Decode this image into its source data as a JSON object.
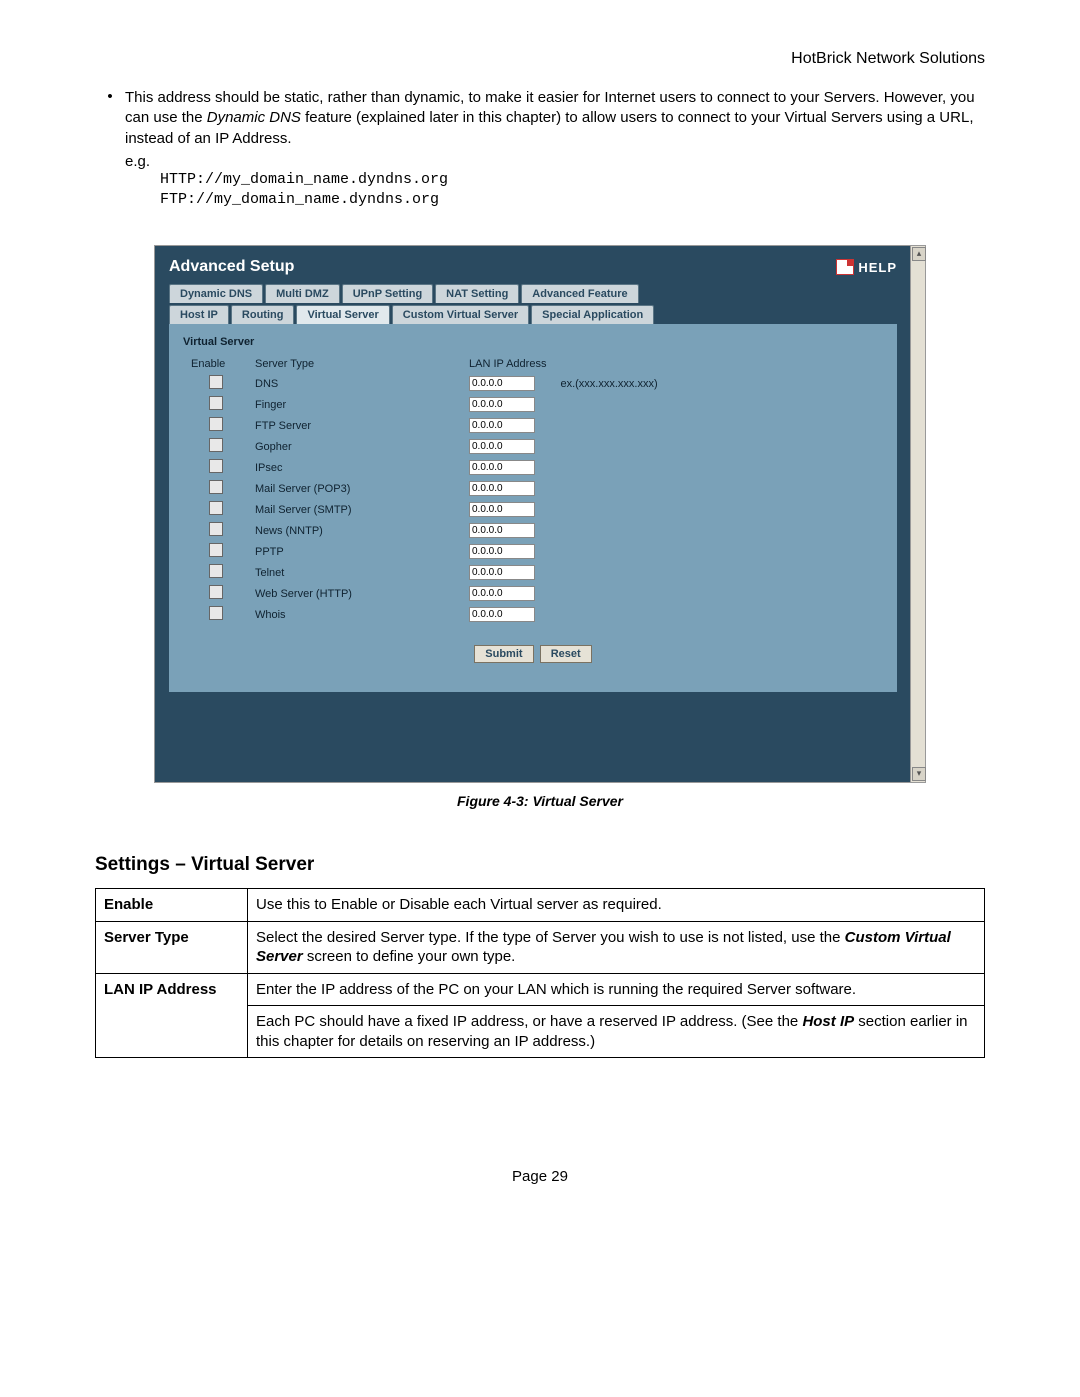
{
  "header": {
    "brand": "HotBrick Network Solutions"
  },
  "intro": {
    "bullet_pre": "This address should be static, rather than dynamic, to make it easier for Internet users to connect to your Servers. However, you can use the ",
    "bullet_em": "Dynamic DNS",
    "bullet_post": " feature (explained later in this chapter) to allow users to connect to your Virtual Servers using a URL, instead of an IP Address.",
    "eg": "e.g.",
    "url1": "HTTP://my_domain_name.dyndns.org",
    "url2": "FTP://my_domain_name.dyndns.org"
  },
  "shot": {
    "title": "Advanced Setup",
    "help": "HELP",
    "tabs_row1": [
      "Dynamic DNS",
      "Multi DMZ",
      "UPnP Setting",
      "NAT Setting",
      "Advanced Feature"
    ],
    "tabs_row2": [
      "Host IP",
      "Routing",
      "Virtual Server",
      "Custom Virtual Server",
      "Special Application"
    ],
    "active_tab": "Virtual Server",
    "panel_title": "Virtual Server",
    "col_enable": "Enable",
    "col_type": "Server Type",
    "col_lan": "LAN IP Address",
    "hint": "ex.(xxx.xxx.xxx.xxx)",
    "rows": [
      {
        "type": "DNS",
        "ip": "0.0.0.0"
      },
      {
        "type": "Finger",
        "ip": "0.0.0.0"
      },
      {
        "type": "FTP Server",
        "ip": "0.0.0.0"
      },
      {
        "type": "Gopher",
        "ip": "0.0.0.0"
      },
      {
        "type": "IPsec",
        "ip": "0.0.0.0"
      },
      {
        "type": "Mail Server (POP3)",
        "ip": "0.0.0.0"
      },
      {
        "type": "Mail Server (SMTP)",
        "ip": "0.0.0.0"
      },
      {
        "type": "News (NNTP)",
        "ip": "0.0.0.0"
      },
      {
        "type": "PPTP",
        "ip": "0.0.0.0"
      },
      {
        "type": "Telnet",
        "ip": "0.0.0.0"
      },
      {
        "type": "Web Server (HTTP)",
        "ip": "0.0.0.0"
      },
      {
        "type": "Whois",
        "ip": "0.0.0.0"
      }
    ],
    "submit": "Submit",
    "reset": "Reset"
  },
  "caption": "Figure 4-3: Virtual Server",
  "section_title": "Settings – Virtual Server",
  "table": {
    "r1l": "Enable",
    "r1v": "Use this to Enable or Disable each Virtual server as required.",
    "r2l": "Server Type",
    "r2v_pre": "Select the desired Server type. If the type of Server you wish to use is not listed, use the ",
    "r2v_em": "Custom Virtual Server",
    "r2v_post": " screen to define your own type.",
    "r3l": "LAN IP Address",
    "r3v1": "Enter the IP address of the PC on your LAN  which is running the required Server software.",
    "r3v2_pre": "Each PC should have a fixed IP address, or have a reserved IP address. (See the ",
    "r3v2_em": "Host IP",
    "r3v2_post": " section earlier in this chapter for details on reserving an IP address.)"
  },
  "pagenum": "Page 29"
}
